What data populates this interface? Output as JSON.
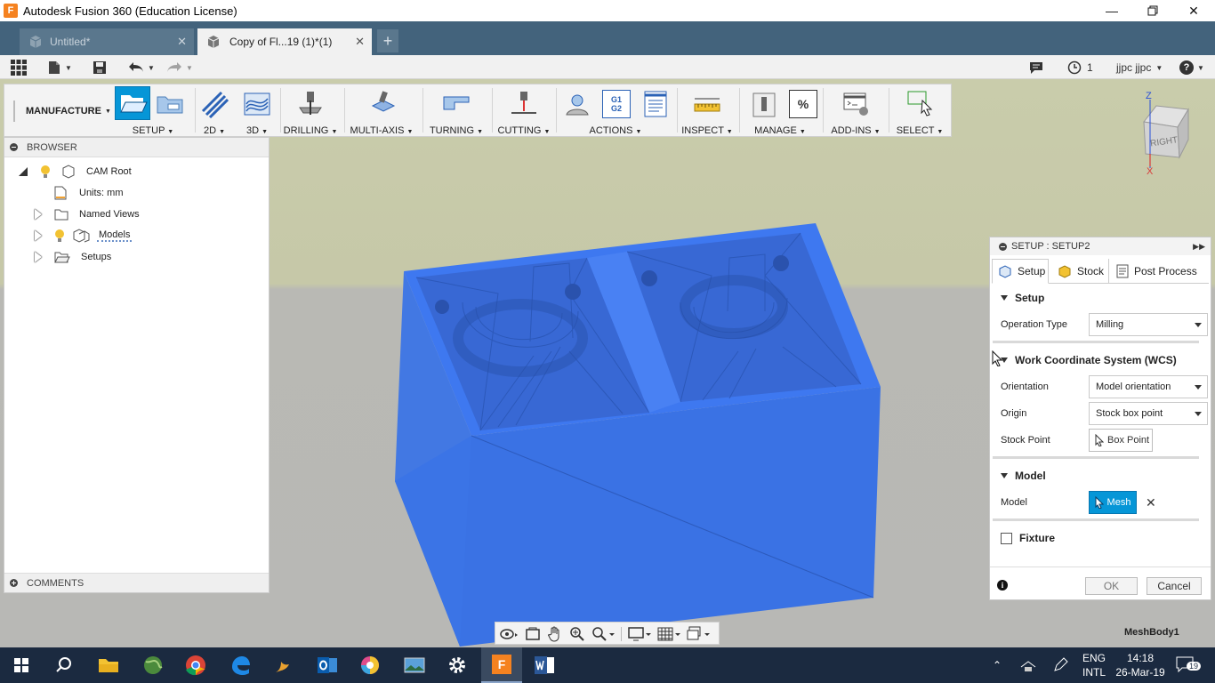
{
  "window": {
    "title": "Autodesk Fusion 360 (Education License)",
    "app_icon_letter": "F"
  },
  "tabs": [
    {
      "label": "Untitled*"
    },
    {
      "label": "Copy of Fl...19 (1)*(1)"
    }
  ],
  "quickbar": {
    "jobs_count": "1",
    "user": "jjpc jjpc",
    "help": "?"
  },
  "ribbon": {
    "workspace": "MANUFACTURE",
    "groups": [
      "SETUP",
      "2D",
      "3D",
      "DRILLING",
      "MULTI-AXIS",
      "TURNING",
      "CUTTING",
      "ACTIONS",
      "INSPECT",
      "MANAGE",
      "ADD-INS",
      "SELECT"
    ],
    "actions_icon_text": [
      "G1",
      "G2"
    ],
    "manage_icon_text": "%"
  },
  "browser": {
    "title": "BROWSER",
    "items": [
      {
        "label": "CAM Root"
      },
      {
        "label": "Units: mm"
      },
      {
        "label": "Named Views"
      },
      {
        "label": "Models"
      },
      {
        "label": "Setups"
      }
    ],
    "comments": "COMMENTS"
  },
  "viewcube": {
    "face": "RIGHT",
    "z": "Z",
    "x": "X"
  },
  "dialog": {
    "title": "SETUP : SETUP2",
    "tabs": [
      "Setup",
      "Stock",
      "Post Process"
    ],
    "setup_section": "Setup",
    "operation_type_label": "Operation Type",
    "operation_type_value": "Milling",
    "wcs_section": "Work Coordinate System (WCS)",
    "orientation_label": "Orientation",
    "orientation_value": "Model orientation",
    "origin_label": "Origin",
    "origin_value": "Stock box point",
    "stock_point_label": "Stock Point",
    "stock_point_value": "Box Point",
    "model_section": "Model",
    "model_label": "Model",
    "model_value": "Mesh",
    "fixture_label": "Fixture",
    "ok": "OK",
    "cancel": "Cancel"
  },
  "status": {
    "selection": "MeshBody1"
  },
  "taskbar": {
    "lang1": "ENG",
    "lang2": "INTL",
    "time": "14:18",
    "date": "26-Mar-19",
    "notifications": "19"
  },
  "colors": {
    "accent": "#0696d7",
    "tabbar": "#43637c",
    "mesh": "#2f6be8",
    "taskbar": "#1b2a40"
  }
}
